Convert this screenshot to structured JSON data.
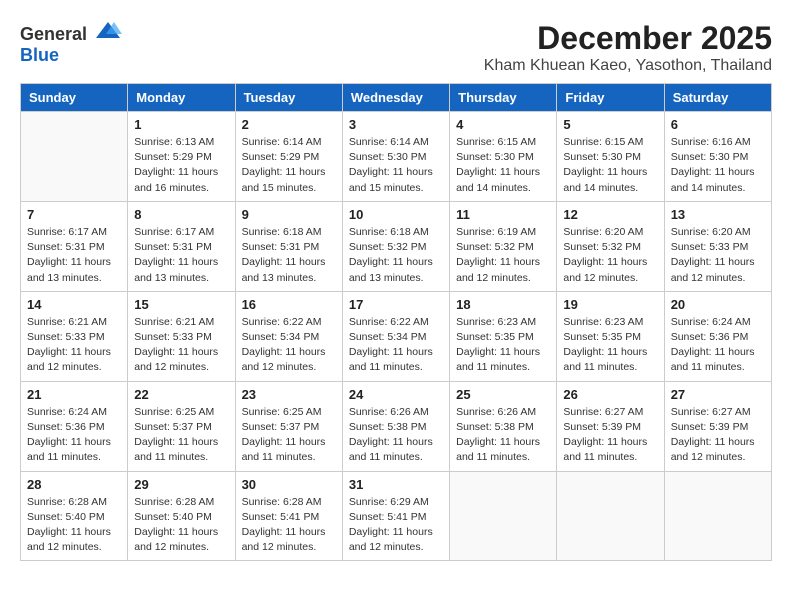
{
  "logo": {
    "general": "General",
    "blue": "Blue"
  },
  "title": "December 2025",
  "subtitle": "Kham Khuean Kaeo, Yasothon, Thailand",
  "weekdays": [
    "Sunday",
    "Monday",
    "Tuesday",
    "Wednesday",
    "Thursday",
    "Friday",
    "Saturday"
  ],
  "weeks": [
    [
      {
        "day": "",
        "info": ""
      },
      {
        "day": "1",
        "info": "Sunrise: 6:13 AM\nSunset: 5:29 PM\nDaylight: 11 hours\nand 16 minutes."
      },
      {
        "day": "2",
        "info": "Sunrise: 6:14 AM\nSunset: 5:29 PM\nDaylight: 11 hours\nand 15 minutes."
      },
      {
        "day": "3",
        "info": "Sunrise: 6:14 AM\nSunset: 5:30 PM\nDaylight: 11 hours\nand 15 minutes."
      },
      {
        "day": "4",
        "info": "Sunrise: 6:15 AM\nSunset: 5:30 PM\nDaylight: 11 hours\nand 14 minutes."
      },
      {
        "day": "5",
        "info": "Sunrise: 6:15 AM\nSunset: 5:30 PM\nDaylight: 11 hours\nand 14 minutes."
      },
      {
        "day": "6",
        "info": "Sunrise: 6:16 AM\nSunset: 5:30 PM\nDaylight: 11 hours\nand 14 minutes."
      }
    ],
    [
      {
        "day": "7",
        "info": "Sunrise: 6:17 AM\nSunset: 5:31 PM\nDaylight: 11 hours\nand 13 minutes."
      },
      {
        "day": "8",
        "info": "Sunrise: 6:17 AM\nSunset: 5:31 PM\nDaylight: 11 hours\nand 13 minutes."
      },
      {
        "day": "9",
        "info": "Sunrise: 6:18 AM\nSunset: 5:31 PM\nDaylight: 11 hours\nand 13 minutes."
      },
      {
        "day": "10",
        "info": "Sunrise: 6:18 AM\nSunset: 5:32 PM\nDaylight: 11 hours\nand 13 minutes."
      },
      {
        "day": "11",
        "info": "Sunrise: 6:19 AM\nSunset: 5:32 PM\nDaylight: 11 hours\nand 12 minutes."
      },
      {
        "day": "12",
        "info": "Sunrise: 6:20 AM\nSunset: 5:32 PM\nDaylight: 11 hours\nand 12 minutes."
      },
      {
        "day": "13",
        "info": "Sunrise: 6:20 AM\nSunset: 5:33 PM\nDaylight: 11 hours\nand 12 minutes."
      }
    ],
    [
      {
        "day": "14",
        "info": "Sunrise: 6:21 AM\nSunset: 5:33 PM\nDaylight: 11 hours\nand 12 minutes."
      },
      {
        "day": "15",
        "info": "Sunrise: 6:21 AM\nSunset: 5:33 PM\nDaylight: 11 hours\nand 12 minutes."
      },
      {
        "day": "16",
        "info": "Sunrise: 6:22 AM\nSunset: 5:34 PM\nDaylight: 11 hours\nand 12 minutes."
      },
      {
        "day": "17",
        "info": "Sunrise: 6:22 AM\nSunset: 5:34 PM\nDaylight: 11 hours\nand 11 minutes."
      },
      {
        "day": "18",
        "info": "Sunrise: 6:23 AM\nSunset: 5:35 PM\nDaylight: 11 hours\nand 11 minutes."
      },
      {
        "day": "19",
        "info": "Sunrise: 6:23 AM\nSunset: 5:35 PM\nDaylight: 11 hours\nand 11 minutes."
      },
      {
        "day": "20",
        "info": "Sunrise: 6:24 AM\nSunset: 5:36 PM\nDaylight: 11 hours\nand 11 minutes."
      }
    ],
    [
      {
        "day": "21",
        "info": "Sunrise: 6:24 AM\nSunset: 5:36 PM\nDaylight: 11 hours\nand 11 minutes."
      },
      {
        "day": "22",
        "info": "Sunrise: 6:25 AM\nSunset: 5:37 PM\nDaylight: 11 hours\nand 11 minutes."
      },
      {
        "day": "23",
        "info": "Sunrise: 6:25 AM\nSunset: 5:37 PM\nDaylight: 11 hours\nand 11 minutes."
      },
      {
        "day": "24",
        "info": "Sunrise: 6:26 AM\nSunset: 5:38 PM\nDaylight: 11 hours\nand 11 minutes."
      },
      {
        "day": "25",
        "info": "Sunrise: 6:26 AM\nSunset: 5:38 PM\nDaylight: 11 hours\nand 11 minutes."
      },
      {
        "day": "26",
        "info": "Sunrise: 6:27 AM\nSunset: 5:39 PM\nDaylight: 11 hours\nand 11 minutes."
      },
      {
        "day": "27",
        "info": "Sunrise: 6:27 AM\nSunset: 5:39 PM\nDaylight: 11 hours\nand 12 minutes."
      }
    ],
    [
      {
        "day": "28",
        "info": "Sunrise: 6:28 AM\nSunset: 5:40 PM\nDaylight: 11 hours\nand 12 minutes."
      },
      {
        "day": "29",
        "info": "Sunrise: 6:28 AM\nSunset: 5:40 PM\nDaylight: 11 hours\nand 12 minutes."
      },
      {
        "day": "30",
        "info": "Sunrise: 6:28 AM\nSunset: 5:41 PM\nDaylight: 11 hours\nand 12 minutes."
      },
      {
        "day": "31",
        "info": "Sunrise: 6:29 AM\nSunset: 5:41 PM\nDaylight: 11 hours\nand 12 minutes."
      },
      {
        "day": "",
        "info": ""
      },
      {
        "day": "",
        "info": ""
      },
      {
        "day": "",
        "info": ""
      }
    ]
  ]
}
